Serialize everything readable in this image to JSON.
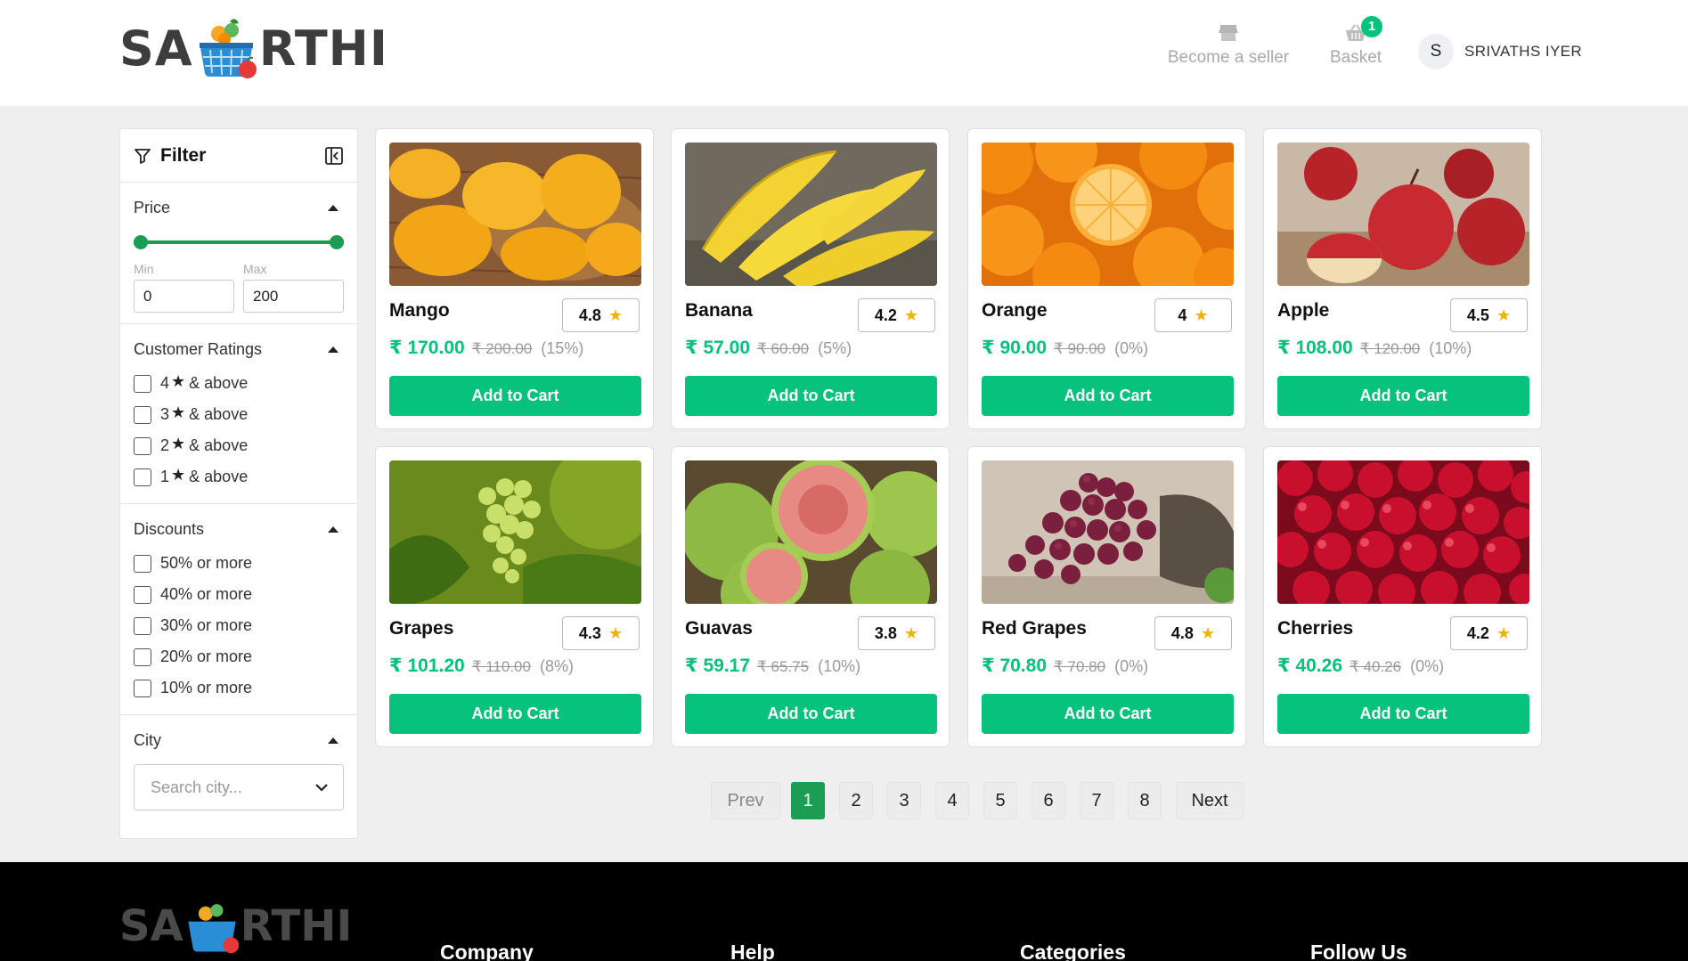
{
  "colors": {
    "brand_green": "#06c27c",
    "slider_green": "#1b9d53",
    "star_gold": "#f0b400"
  },
  "header": {
    "logo_left": "SA",
    "logo_right": "RTHI",
    "seller_label": "Become a seller",
    "basket_label": "Basket",
    "basket_count": "1",
    "user_initial": "S",
    "user_name": "SRIVATHS IYER"
  },
  "filter": {
    "title": "Filter",
    "price": {
      "label": "Price",
      "min_label": "Min",
      "max_label": "Max",
      "min_value": "0",
      "max_value": "200"
    },
    "ratings": {
      "label": "Customer Ratings",
      "options": [
        {
          "num": "4",
          "text": "& above"
        },
        {
          "num": "3",
          "text": "& above"
        },
        {
          "num": "2",
          "text": "& above"
        },
        {
          "num": "1",
          "text": "& above"
        }
      ]
    },
    "discounts": {
      "label": "Discounts",
      "options": [
        "50% or more",
        "40% or more",
        "30% or more",
        "20% or more",
        "10% or more"
      ]
    },
    "city": {
      "label": "City",
      "placeholder": "Search city..."
    }
  },
  "products": [
    {
      "name": "Mango",
      "rating": "4.8",
      "price": "₹ 170.00",
      "mrp": "₹ 200.00",
      "discount": "(15%)",
      "button": "Add to Cart"
    },
    {
      "name": "Banana",
      "rating": "4.2",
      "price": "₹ 57.00",
      "mrp": "₹ 60.00",
      "discount": "(5%)",
      "button": "Add to Cart"
    },
    {
      "name": "Orange",
      "rating": "4",
      "price": "₹ 90.00",
      "mrp": "₹ 90.00",
      "discount": "(0%)",
      "button": "Add to Cart"
    },
    {
      "name": "Apple",
      "rating": "4.5",
      "price": "₹ 108.00",
      "mrp": "₹ 120.00",
      "discount": "(10%)",
      "button": "Add to Cart"
    },
    {
      "name": "Grapes",
      "rating": "4.3",
      "price": "₹ 101.20",
      "mrp": "₹ 110.00",
      "discount": "(8%)",
      "button": "Add to Cart"
    },
    {
      "name": "Guavas",
      "rating": "3.8",
      "price": "₹ 59.17",
      "mrp": "₹ 65.75",
      "discount": "(10%)",
      "button": "Add to Cart"
    },
    {
      "name": "Red Grapes",
      "rating": "4.8",
      "price": "₹ 70.80",
      "mrp": "₹ 70.80",
      "discount": "(0%)",
      "button": "Add to Cart"
    },
    {
      "name": "Cherries",
      "rating": "4.2",
      "price": "₹ 40.26",
      "mrp": "₹ 40.26",
      "discount": "(0%)",
      "button": "Add to Cart"
    }
  ],
  "pagination": {
    "prev": "Prev",
    "next": "Next",
    "pages": [
      "1",
      "2",
      "3",
      "4",
      "5",
      "6",
      "7",
      "8"
    ],
    "current": "1"
  },
  "footer": {
    "columns": [
      "Company",
      "Help",
      "Categories",
      "Follow Us"
    ]
  }
}
